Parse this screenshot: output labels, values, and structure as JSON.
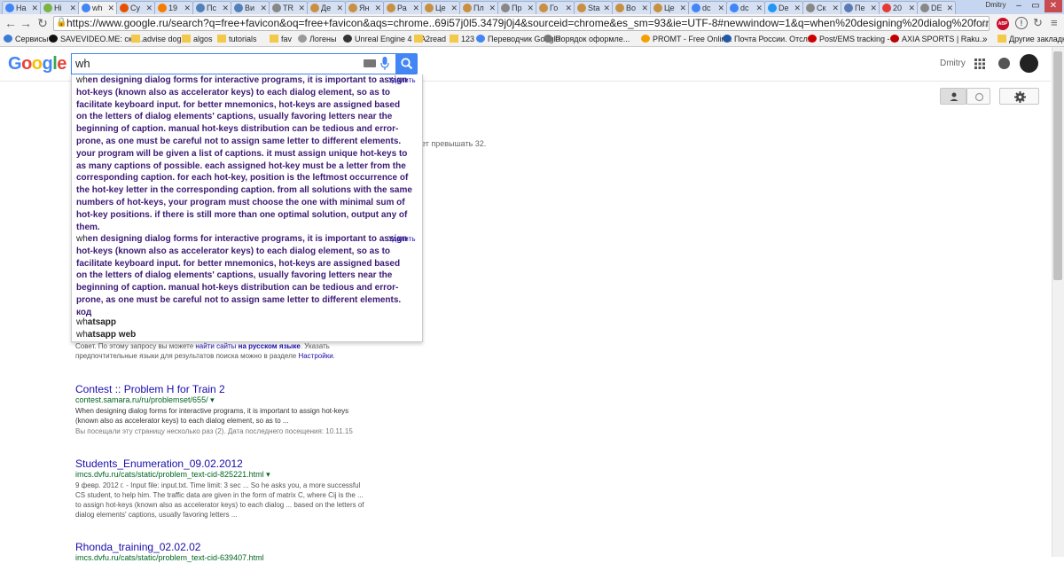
{
  "browser": {
    "tabs": [
      {
        "label": "Ha",
        "icon": "google-icon",
        "color": "#4285f4"
      },
      {
        "label": "Hi",
        "icon": "chart-icon",
        "color": "#7cb342"
      },
      {
        "label": "wh",
        "icon": "google-icon",
        "color": "#4285f4",
        "active": true
      },
      {
        "label": "Cy",
        "icon": "page-icon",
        "color": "#e65100"
      },
      {
        "label": "19",
        "icon": "dot-icon",
        "color": "#f57c00"
      },
      {
        "label": "Пс",
        "icon": "vk-icon",
        "color": "#5181b8"
      },
      {
        "label": "Ви",
        "icon": "vk-icon",
        "color": "#5181b8"
      },
      {
        "label": "TR",
        "icon": "doc-icon",
        "color": "#888888"
      },
      {
        "label": "Де",
        "icon": "dot-icon",
        "color": "#c89040"
      },
      {
        "label": "Ян",
        "icon": "dot-icon",
        "color": "#c89040"
      },
      {
        "label": "Ра",
        "icon": "dot-icon",
        "color": "#c89040"
      },
      {
        "label": "Це",
        "icon": "dot-icon",
        "color": "#c89040"
      },
      {
        "label": "Пл",
        "icon": "dot-icon",
        "color": "#c89040"
      },
      {
        "label": "Пр",
        "icon": "doc-icon",
        "color": "#888888"
      },
      {
        "label": "Го",
        "icon": "dot-icon",
        "color": "#c89040"
      },
      {
        "label": "Sta",
        "icon": "dot-icon",
        "color": "#c89040"
      },
      {
        "label": "Во",
        "icon": "dot-icon",
        "color": "#c89040"
      },
      {
        "label": "Це",
        "icon": "dot-icon",
        "color": "#c89040"
      },
      {
        "label": "dc",
        "icon": "google-icon",
        "color": "#4285f4"
      },
      {
        "label": "dc",
        "icon": "google-icon",
        "color": "#4285f4"
      },
      {
        "label": "De",
        "icon": "cloud-icon",
        "color": "#2196f3"
      },
      {
        "label": "Ск",
        "icon": "doc-icon",
        "color": "#888888"
      },
      {
        "label": "Пе",
        "icon": "doc-icon",
        "color": "#5c7bb5"
      },
      {
        "label": "20",
        "icon": "image-icon",
        "color": "#e53935"
      },
      {
        "label": "DE",
        "icon": "doc-icon",
        "color": "#888888"
      }
    ],
    "user_tab_label": "Dmitry",
    "url": "https://www.google.ru/search?q=free+favicon&oq=free+favicon&aqs=chrome..69i57j0l5.3479j0j4&sourceid=chrome&es_sm=93&ie=UTF-8#newwindow=1&q=when%20designing%20dialog%20forms%20for%20interactive%20progr…",
    "abp_badge": "ABP"
  },
  "bookmarks": [
    {
      "label": "Сервисы",
      "icon": "apps-grid-icon"
    },
    {
      "label": "SAVEVIDEO.ME: ска...",
      "icon": "savevideo-icon"
    },
    {
      "label": "advise dog",
      "icon": "folder-icon"
    },
    {
      "label": "algos",
      "icon": "folder-icon"
    },
    {
      "label": "tutorials",
      "icon": "folder-icon"
    },
    {
      "label": "fav",
      "icon": "folder-icon"
    },
    {
      "label": "Логены",
      "icon": "doc-icon"
    },
    {
      "label": "Unreal Engine 4 + A...",
      "icon": "unreal-icon"
    },
    {
      "label": "2read",
      "icon": "folder-icon"
    },
    {
      "label": "123",
      "icon": "folder-icon"
    },
    {
      "label": "Переводчик Google",
      "icon": "translate-icon"
    },
    {
      "label": "Порядок оформле...",
      "icon": "page-icon"
    },
    {
      "label": "PROMT - Free Onlin...",
      "icon": "promt-icon"
    },
    {
      "label": "Почта России. Отсл...",
      "icon": "post-icon"
    },
    {
      "label": "Post/EMS tracking - ...",
      "icon": "tracking-icon"
    },
    {
      "label": "AXIA SPORTS | Raku...",
      "icon": "rakuten-icon"
    }
  ],
  "bookmarks_more": "»",
  "other_bookmarks": "Другие закладки",
  "google": {
    "logo": "Google",
    "search_value": "wh",
    "user_name": "Dmitry"
  },
  "hidden_text": "ет превышать 32.",
  "suggestions": {
    "long1": "en designing dialog forms for interactive programs, it is important to assign hot-keys (known also as accelerator keys) to each dialog element, so as to facilitate keyboard input. for better mnemonics, hot-keys are assigned based on the letters of dialog elements' captions, usually favoring letters near the beginning of caption. manual hot-keys distribution can be tedious and error-prone, as one must be careful not to assign same letter to different elements. your program will be given a list of captions. it must assign unique hot-keys to as many captions of possible. each assigned hot-key must be a letter from the corresponding caption. for each hot-key, position is the leftmost occurrence of the hot-key letter in the corresponding caption. from all solutions with the same numbers of hot-keys, your program must choose the one with minimal sum of hot-key positions. if there is still more than one optimal solution, output any of them.",
    "long2": "en designing dialog forms for interactive programs, it is important to assign hot-keys (known also as accelerator keys) to each dialog element, so as to facilitate keyboard input. for better mnemonics, hot-keys are assigned based on the letters of dialog elements' captions, usually favoring letters near the beginning of caption. manual hot-keys distribution can be tedious and error-prone, as one must be careful not to assign same letter to different elements. код",
    "typed": "wh",
    "delete_label": "Удалить",
    "short1": "atsapp",
    "short2": "atsapp web"
  },
  "notice": {
    "prefix": "Совет. По этому запросу вы можете ",
    "link1": "найти сайты",
    "bold": " на русском языке",
    "middle": ". Указать предпочтительные языки для результатов поиска можно в разделе ",
    "link2": "Настройки",
    "suffix": "."
  },
  "results": [
    {
      "title": "Contest :: Problem H for Train 2",
      "url": "contest.samara.ru/ru/problemset/655/",
      "snippet": "When designing dialog forms for interactive programs, it is important to assign hot-keys (known also as accelerator keys) to each dialog element, so as to ...",
      "visited": "Вы посещали эту страницу несколько раз (2). Дата последнего посещения: 10.11.15"
    },
    {
      "title": "Students_Enumeration_09.02.2012",
      "url": "imcs.dvfu.ru/cats/static/problem_text-cid-825221.html",
      "snippet": "9 февр. 2012 г. - Input file: input.txt. Time limit: 3 sec ... So he asks you, a more successful CS student, to help him. The traffic data are given in the form of matrix C, where Cij is the ... to assign hot-keys (known also as accelerator keys) to each dialog ... based on the letters of dialog elements' captions, usually favoring letters ..."
    },
    {
      "title": "Rhonda_training_02.02.02",
      "url": "imcs.dvfu.ru/cats/static/problem_text-cid-639407.html"
    }
  ]
}
